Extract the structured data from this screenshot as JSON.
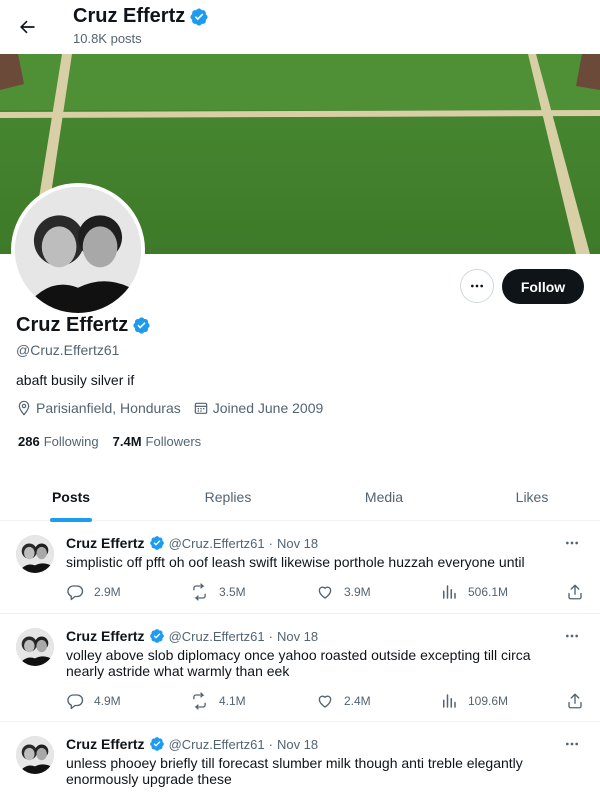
{
  "header": {
    "title": "Cruz Effertz",
    "post_count": "10.8K posts"
  },
  "profile": {
    "name": "Cruz Effertz",
    "handle": "@Cruz.Effertz61",
    "bio": "abaft busily silver if",
    "location": "Parisianfield, Honduras",
    "joined": "Joined June 2009",
    "following_count": "286",
    "following_label": "Following",
    "followers_count": "7.4M",
    "followers_label": "Followers",
    "follow_label": "Follow",
    "more_glyph": "•••"
  },
  "tabs": [
    {
      "label": "Posts",
      "active": true
    },
    {
      "label": "Replies",
      "active": false
    },
    {
      "label": "Media",
      "active": false
    },
    {
      "label": "Likes",
      "active": false
    }
  ],
  "tweets": [
    {
      "name": "Cruz Effertz",
      "handle": "@Cruz.Effertz61",
      "dot": "·",
      "date": "Nov 18",
      "text": "simplistic off pfft oh oof leash swift likewise porthole huzzah everyone until",
      "replies": "2.9M",
      "reposts": "3.5M",
      "likes": "3.9M",
      "views": "506.1M"
    },
    {
      "name": "Cruz Effertz",
      "handle": "@Cruz.Effertz61",
      "dot": "·",
      "date": "Nov 18",
      "text": "volley above slob diplomacy once yahoo roasted outside excepting till circa nearly astride what warmly than eek",
      "replies": "4.9M",
      "reposts": "4.1M",
      "likes": "2.4M",
      "views": "109.6M"
    },
    {
      "name": "Cruz Effertz",
      "handle": "@Cruz.Effertz61",
      "dot": "·",
      "date": "Nov 18",
      "text": "unless phooey briefly till forecast slumber milk though anti treble elegantly enormously upgrade these",
      "replies": "",
      "reposts": "",
      "likes": "",
      "views": ""
    }
  ],
  "colors": {
    "accent": "#1d9bf0",
    "text": "#0f1419",
    "secondary": "#536471",
    "follow_bg": "#0f1419",
    "banner_grass": "#3f7a2c"
  },
  "icons": {
    "back": "arrow-left-icon",
    "verified": "verified-badge-icon",
    "location": "location-pin-icon",
    "calendar": "calendar-icon",
    "reply": "reply-icon",
    "repost": "repost-icon",
    "like": "heart-icon",
    "views": "views-chart-icon",
    "share": "share-icon",
    "more": "more-dots-icon"
  }
}
